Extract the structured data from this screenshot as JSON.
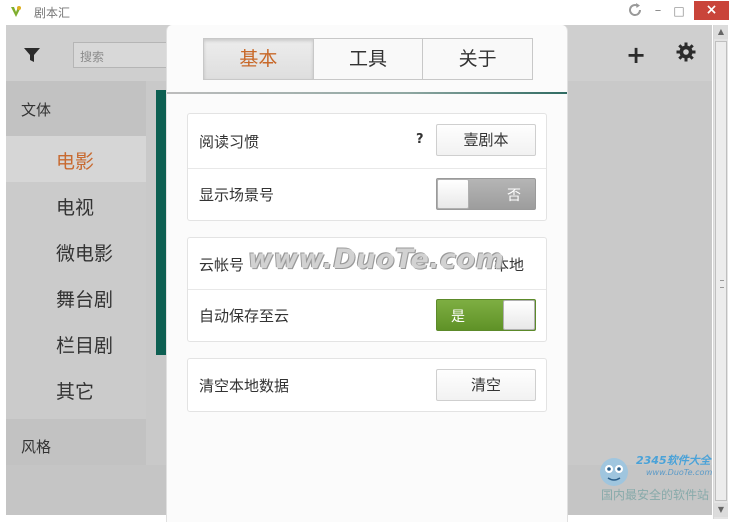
{
  "window": {
    "title": "剧本汇"
  },
  "underlay": {
    "search_placeholder": "搜索",
    "sidebar": {
      "header_top": "文体",
      "items": [
        {
          "label": "电影",
          "active": true
        },
        {
          "label": "电视",
          "active": false
        },
        {
          "label": "微电影",
          "active": false
        },
        {
          "label": "舞台剧",
          "active": false
        },
        {
          "label": "栏目剧",
          "active": false
        },
        {
          "label": "其它",
          "active": false
        }
      ],
      "header_bottom": "风格"
    }
  },
  "settings": {
    "tabs": [
      {
        "label": "基本",
        "active": true
      },
      {
        "label": "工具",
        "active": false
      },
      {
        "label": "关于",
        "active": false
      }
    ],
    "group1": {
      "reading_habit_label": "阅读习惯",
      "help_symbol": "?",
      "reading_habit_value": "壹剧本",
      "show_scene_label": "显示场景号",
      "show_scene_toggle": {
        "state": "off",
        "text": "否"
      }
    },
    "group2": {
      "cloud_account_label": "云帐号",
      "cloud_account_value": "本地",
      "autosave_label": "自动保存至云",
      "autosave_toggle": {
        "state": "on",
        "text": "是"
      }
    },
    "group3": {
      "clear_label": "清空本地数据",
      "clear_button": "清空"
    }
  },
  "watermarks": {
    "center": "www.DuoTe.com",
    "brand": "2345软件大全",
    "brand_url": "www.DuoTe.com",
    "slogan": "国内最安全的软件站"
  },
  "colors": {
    "accent_orange": "#c8692a",
    "toggle_on_green": "#6fa136",
    "close_red": "#c9443a",
    "teal_card": "#0d5f52"
  }
}
